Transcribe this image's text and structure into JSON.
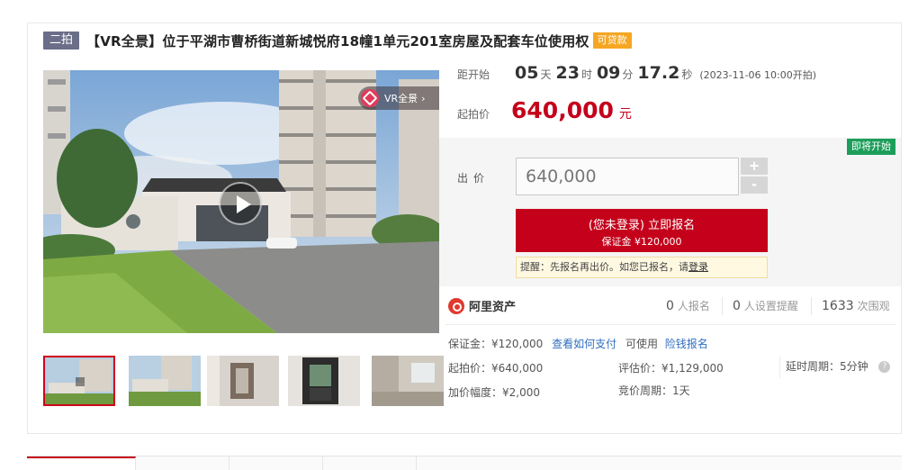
{
  "header": {
    "round_tag": "二拍",
    "title": "【VR全景】位于平湖市曹桥街道新城悦府18幢1单元201室房屋及配套车位使用权",
    "loan_tag": "可贷款"
  },
  "gallery": {
    "vr_label": "VR全景",
    "vr_arrow": "›",
    "thumbnails": [
      "exterior-video",
      "exterior",
      "interior-corridor",
      "interior-window",
      "interior-living-room"
    ]
  },
  "countdown": {
    "label": "距开始",
    "days": "05",
    "days_unit": "天",
    "hours": "23",
    "hours_unit": "时",
    "minutes": "09",
    "minutes_unit": "分",
    "seconds": "17.2",
    "seconds_unit": "秒",
    "start_time": "(2023-11-06 10:00开拍)"
  },
  "start_price": {
    "label": "起拍价",
    "value": "640,000",
    "unit": "元"
  },
  "bid": {
    "status": "即将开始",
    "label": "出价",
    "value": "640,000",
    "plus": "+",
    "minus": "-",
    "signup_main": "(您未登录) 立即报名",
    "signup_sub": "保证金 ¥120,000",
    "tip_text": "提醒：先报名再出价。如您已报名，请",
    "tip_link": "登录"
  },
  "stats": {
    "brand": "阿里资产",
    "signups": "0",
    "signups_label": "人报名",
    "reminders": "0",
    "reminders_label": "人设置提醒",
    "views": "1633",
    "views_label": "次围观"
  },
  "details": {
    "deposit_label": "保证金：",
    "deposit": "¥120,000",
    "pay_link": "查看如何支付",
    "usable_text": "可使用",
    "credit_link": "险钱报名",
    "start_price_label": "起拍价：",
    "start_price": "¥640,000",
    "appraisal_label": "评估价：",
    "appraisal": "¥1,129,000",
    "delay_label": "延时周期：",
    "delay": "5分钟",
    "help": "?",
    "increment_label": "加价幅度：",
    "increment": "¥2,000",
    "cycle_label": "竞价周期：",
    "cycle": "1天"
  },
  "colors": {
    "accent": "#c4001b",
    "status_green": "#1c9e5a",
    "loan_orange": "#f5a623",
    "round_tag": "#6b6e88",
    "link_blue": "#2f6ebf"
  }
}
